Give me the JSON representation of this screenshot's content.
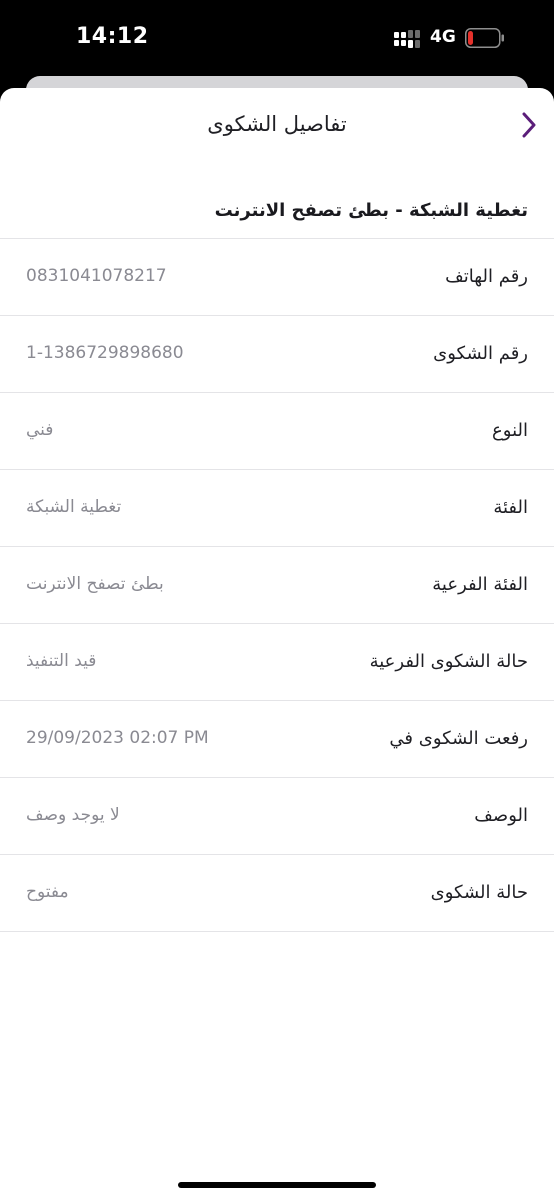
{
  "status_bar": {
    "time": "14:12",
    "network": "4G",
    "battery_color": "#e5312b"
  },
  "header": {
    "title": "تفاصيل الشكوى",
    "back_icon": "chevron-right-icon",
    "accent_color": "#5b1e7a"
  },
  "complaint": {
    "title": "تغطية الشبكة - بطئ تصفح الانترنت"
  },
  "details": [
    {
      "label": "رقم الهاتف",
      "value": "0831041078217"
    },
    {
      "label": "رقم الشكوى",
      "value": "1-1386729898680"
    },
    {
      "label": "النوع",
      "value": "فني"
    },
    {
      "label": "الفئة",
      "value": "تغطية الشبكة"
    },
    {
      "label": "الفئة الفرعية",
      "value": "بطئ تصفح الانترنت"
    },
    {
      "label": "حالة الشكوى الفرعية",
      "value": "قيد التنفيذ"
    },
    {
      "label": "رفعت الشكوى في",
      "value": "29/09/2023 02:07 PM"
    },
    {
      "label": "الوصف",
      "value": "لا يوجد وصف"
    },
    {
      "label": "حالة الشكوى",
      "value": "مفتوح"
    }
  ]
}
